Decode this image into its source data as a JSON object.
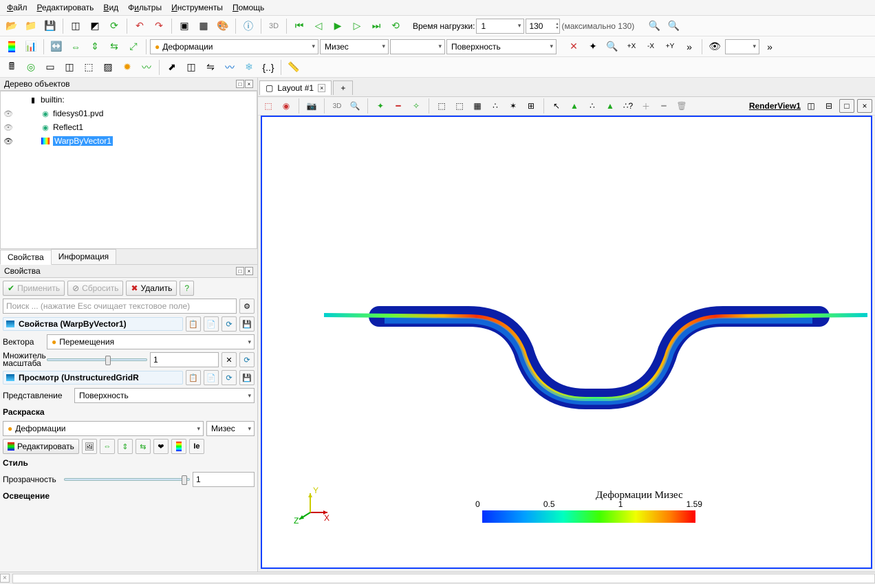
{
  "menu": {
    "file": "Файл",
    "edit": "Редактировать",
    "view": "Вид",
    "filters": "Фильтры",
    "tools": "Инструменты",
    "help": "Помощь"
  },
  "tb1": {
    "time_label": "Время нагрузки:",
    "time_value": "1",
    "time_max": "130",
    "time_hint": "(максимально 130)"
  },
  "tb2": {
    "field": "Деформации",
    "comp": "Мизес",
    "repr": "Поверхность"
  },
  "tree": {
    "title": "Дерево объектов",
    "items": [
      "builtin:",
      "fidesys01.pvd",
      "Reflect1",
      "WarpByVector1"
    ]
  },
  "tabs": {
    "props": "Свойства",
    "info": "Информация"
  },
  "props": {
    "title": "Свойства",
    "apply": "Применить",
    "reset": "Сбросить",
    "delete": "Удалить",
    "search_ph": "Поиск ... (нажатие Esc очищает текстовое поле)",
    "group1": "Свойства (WarpByVector1)",
    "vectors_lbl": "Вектора",
    "vectors_val": "Перемещения",
    "scale_lbl1": "Множитель",
    "scale_lbl2": "масштаба",
    "scale_val": "1",
    "group2": "Просмотр (UnstructuredGridR",
    "repr_lbl": "Представление",
    "repr_val": "Поверхность",
    "color_lbl": "Раскраска",
    "color_field": "Деформации",
    "color_comp": "Мизес",
    "edit": "Редактировать",
    "style_lbl": "Стиль",
    "opacity_lbl": "Прозрачность",
    "opacity_val": "1",
    "light_lbl": "Освещение"
  },
  "layout": {
    "tab": "Layout #1",
    "view": "RenderView1"
  },
  "legend": {
    "title": "Деформации Мизес",
    "ticks": [
      "0",
      "0.5",
      "1",
      "1.59"
    ]
  },
  "axis": {
    "x": "X",
    "y": "Y",
    "z": "Z"
  }
}
